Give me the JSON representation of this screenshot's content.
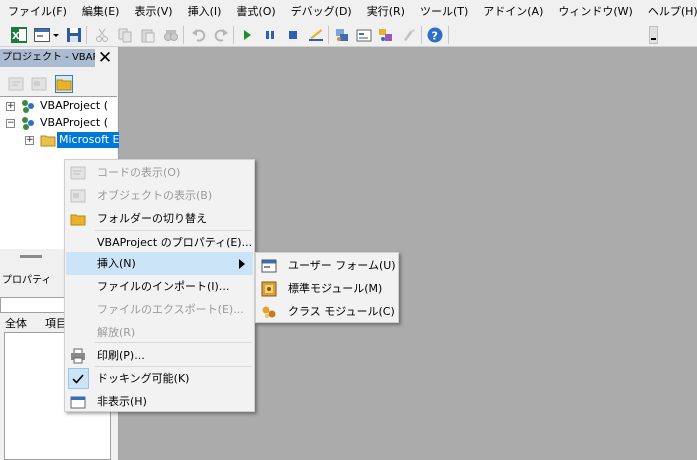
{
  "menubar": {
    "items": [
      "ファイル(F)",
      "編集(E)",
      "表示(V)",
      "挿入(I)",
      "書式(O)",
      "デバッグ(D)",
      "実行(R)",
      "ツール(T)",
      "アドイン(A)",
      "ウィンドウ(W)",
      "ヘルプ(H)"
    ]
  },
  "toolbar": {
    "icons": [
      "excel-icon",
      "insert-userform-icon",
      "save-icon",
      "cut-icon",
      "copy-icon",
      "paste-icon",
      "find-icon",
      "undo-icon",
      "redo-icon",
      "run-icon",
      "break-icon",
      "reset-icon",
      "design-mode-icon",
      "project-explorer-icon",
      "properties-icon",
      "object-browser-icon",
      "toolbox-icon",
      "help-icon"
    ]
  },
  "project_pane": {
    "title": "プロジェクト - VBAProj",
    "tree": [
      {
        "label": "VBAProject (",
        "expanded": false
      },
      {
        "label": "VBAProject (",
        "expanded": true
      },
      {
        "label": "Microsoft E",
        "selected": true
      }
    ]
  },
  "properties_pane": {
    "title": "プロパティ",
    "tabs": [
      "全体",
      "項目"
    ]
  },
  "context_menu": {
    "items": [
      {
        "label": "コードの表示(O)",
        "icon": "code-icon",
        "disabled": true
      },
      {
        "label": "オブジェクトの表示(B)",
        "icon": "object-icon",
        "disabled": true
      },
      {
        "label": "フォルダーの切り替え",
        "icon": "folder-icon",
        "disabled": false
      },
      {
        "label": "VBAProject のプロパティ(E)...",
        "disabled": false
      },
      {
        "label": "挿入(N)",
        "disabled": false,
        "highlighted": true,
        "submenu": true
      },
      {
        "label": "ファイルのインポート(I)...",
        "disabled": false
      },
      {
        "label": "ファイルのエクスポート(E)...",
        "disabled": true
      },
      {
        "label": "解放(R)",
        "disabled": true
      },
      {
        "label": "印刷(P)...",
        "icon": "print-icon",
        "disabled": false
      },
      {
        "label": "ドッキング可能(K)",
        "icon": "check-icon",
        "checked": true,
        "disabled": false
      },
      {
        "label": "非表示(H)",
        "icon": "hide-window-icon",
        "disabled": false
      }
    ]
  },
  "submenu": {
    "items": [
      {
        "label": "ユーザー フォーム(U)",
        "icon": "userform-icon"
      },
      {
        "label": "標準モジュール(M)",
        "icon": "module-icon"
      },
      {
        "label": "クラス モジュール(C)",
        "icon": "class-module-icon"
      }
    ]
  },
  "colors": {
    "workspace": "#ababab",
    "highlight": "#cce4f7",
    "tree_selection": "#0078d7",
    "pane_title": "#aabbd2"
  }
}
